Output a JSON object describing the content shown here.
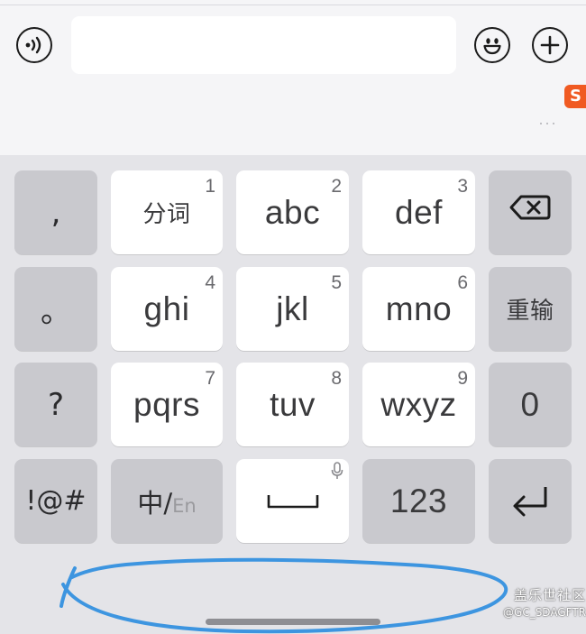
{
  "toolbar": {
    "voice_icon": "voice-wave-icon",
    "input_value": "",
    "emoji_icon": "smiley-face-icon",
    "add_icon": "plus-icon",
    "logo_text": "S",
    "more_text": "···",
    "logo_color": "#f05a22"
  },
  "keyboard": {
    "row1": {
      "punct": ",",
      "keys": [
        {
          "label": "分词",
          "num": "1"
        },
        {
          "label": "abc",
          "num": "2"
        },
        {
          "label": "def",
          "num": "3"
        }
      ],
      "backspace_icon": "backspace-icon"
    },
    "row2": {
      "punct": "。",
      "keys": [
        {
          "label": "ghi",
          "num": "4"
        },
        {
          "label": "jkl",
          "num": "5"
        },
        {
          "label": "mno",
          "num": "6"
        }
      ],
      "retype": "重输"
    },
    "row3": {
      "punct": "?",
      "keys": [
        {
          "label": "pqrs",
          "num": "7"
        },
        {
          "label": "tuv",
          "num": "8"
        },
        {
          "label": "wxyz",
          "num": "9"
        }
      ],
      "zero": "0"
    },
    "row4": {
      "symbols": "!@#",
      "lang_zh": "中/",
      "lang_en": "En",
      "space_icon": "space-bar-icon",
      "mic_icon": "microphone-icon",
      "numbers": "123",
      "enter_icon": "return-arrow-icon"
    }
  },
  "watermark": {
    "line1": "盖乐世社区",
    "line2": "@GC_SDAGFTR"
  },
  "colors": {
    "keyboard_bg": "#e4e4e8",
    "light_key": "#ffffff",
    "dark_key": "#c9c9ce",
    "scribble": "#3d95e0"
  }
}
